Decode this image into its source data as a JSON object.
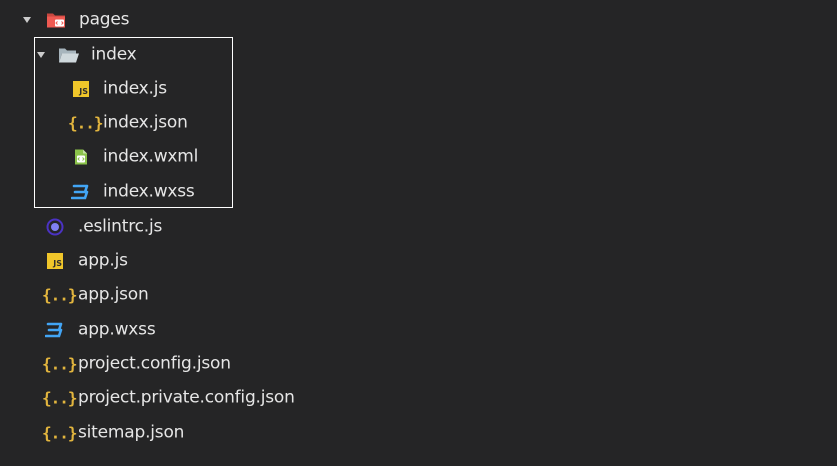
{
  "tree": {
    "pages_folder": {
      "label": "pages",
      "icon": "folder-pages-icon",
      "expanded": true
    },
    "index_folder": {
      "label": "index",
      "icon": "folder-open-icon",
      "expanded": true
    },
    "index_files": [
      {
        "label": "index.js",
        "icon": "js-file-icon"
      },
      {
        "label": "index.json",
        "icon": "json-file-icon"
      },
      {
        "label": "index.wxml",
        "icon": "wxml-file-icon"
      },
      {
        "label": "index.wxss",
        "icon": "css-file-icon"
      }
    ],
    "root_files": [
      {
        "label": ".eslintrc.js",
        "icon": "eslint-file-icon"
      },
      {
        "label": "app.js",
        "icon": "js-file-icon"
      },
      {
        "label": "app.json",
        "icon": "json-file-icon"
      },
      {
        "label": "app.wxss",
        "icon": "css-file-icon"
      },
      {
        "label": "project.config.json",
        "icon": "json-file-icon"
      },
      {
        "label": "project.private.config.json",
        "icon": "json-file-icon"
      },
      {
        "label": "sitemap.json",
        "icon": "json-file-icon"
      }
    ]
  },
  "icons": {
    "js_badge_text": "JS",
    "json_glyph": "{..}"
  },
  "colors": {
    "background": "#252526",
    "text": "#e6e6e6",
    "js": "#f0c62a",
    "json": "#e2b53e",
    "wxml": "#8bc34a",
    "css": "#42a5f5",
    "eslint": "#4b32c3",
    "folder": "#90a4ae",
    "folder_pages": "#ef5350",
    "selection_border": "#ffffff"
  }
}
